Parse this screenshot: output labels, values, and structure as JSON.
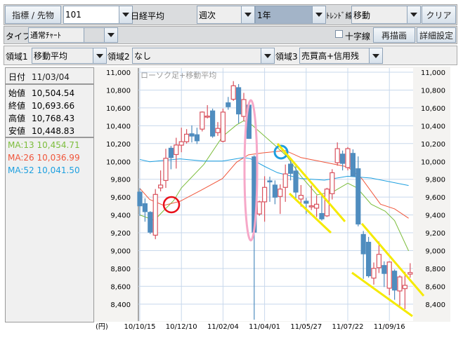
{
  "toolbar1": {
    "index_button": "指標 / 先物",
    "code_value": "101",
    "index_name": "日経平均",
    "period_value": "週次",
    "range_value": "1年",
    "trend_label": "ﾄﾚﾝﾄﾞ線",
    "trend_value": "移動",
    "clear_button": "クリア"
  },
  "toolbar2": {
    "type_label": "タイプ",
    "type_value": "通常ﾁｬｰﾄ",
    "crosshair_label": "十字線",
    "crosshair_checked": false,
    "redraw_button": "再描画",
    "settings_button": "詳細設定"
  },
  "toolbar3": {
    "area1_label": "領域1",
    "area1_value": "移動平均",
    "area2_label": "領域2",
    "area2_value": "なし",
    "area3_label": "領域3",
    "area3_value": "売買高+信用残"
  },
  "info": {
    "date_label": "日付",
    "date_value": "11/03/04",
    "open_label": "始値",
    "open_value": "10,504.54",
    "close_label": "終値",
    "close_value": "10,693.66",
    "high_label": "高値",
    "high_value": "10,768.43",
    "low_label": "安値",
    "low_value": "10,448.83",
    "ma13_label": "MA:13",
    "ma13_value": "10,454.71",
    "ma26_label": "MA:26",
    "ma26_value": "10,036.99",
    "ma52_label": "MA:52",
    "ma52_value": "10,041.50"
  },
  "colors": {
    "up": "#d9525e",
    "down": "#4f8dbf",
    "ma13": "#7cbd3c",
    "ma26": "#f0553a",
    "ma52": "#1ea0e0",
    "grid": "#c8d8ec"
  },
  "chart_data": {
    "type": "candlestick",
    "title": "ローソク足+移動平均",
    "unit_label": "(円)",
    "ylim": [
      8200,
      11000
    ],
    "yticks": [
      "11,000",
      "10,800",
      "10,600",
      "10,400",
      "10,200",
      "10,000",
      "9,800",
      "9,600",
      "9,400",
      "9,200",
      "9,000",
      "8,800",
      "8,600",
      "8,400"
    ],
    "ytick_values": [
      11000,
      10800,
      10600,
      10400,
      10200,
      10000,
      9800,
      9600,
      9400,
      9200,
      9000,
      8800,
      8600,
      8400
    ],
    "xticks": [
      {
        "index": 1,
        "label": "10/10/15"
      },
      {
        "index": 9,
        "label": "10/12/10"
      },
      {
        "index": 17,
        "label": "11/02/04"
      },
      {
        "index": 25,
        "label": "11/04/01"
      },
      {
        "index": 33,
        "label": "11/05/27"
      },
      {
        "index": 41,
        "label": "11/07/22"
      },
      {
        "index": 49,
        "label": "11/09/16"
      }
    ],
    "ohlc": [
      [
        9656,
        9700,
        9390,
        9502
      ],
      [
        9526,
        9586,
        9324,
        9437
      ],
      [
        9429,
        9442,
        9186,
        9207
      ],
      [
        9173,
        9690,
        9128,
        9630
      ],
      [
        9703,
        9899,
        9664,
        9735
      ],
      [
        9787,
        10142,
        9703,
        10035
      ],
      [
        10148,
        10174,
        9912,
        10043
      ],
      [
        10077,
        10265,
        9920,
        10184
      ],
      [
        10182,
        10378,
        10103,
        10221
      ],
      [
        10221,
        10362,
        10200,
        10305
      ],
      [
        10310,
        10404,
        10213,
        10284
      ],
      [
        10299,
        10378,
        10195,
        10231
      ],
      [
        10362,
        10561,
        10336,
        10553
      ],
      [
        10498,
        10631,
        10482,
        10508
      ],
      [
        10566,
        10592,
        10265,
        10284
      ],
      [
        10323,
        10441,
        10286,
        10370
      ],
      [
        10226,
        10592,
        10213,
        10553
      ],
      [
        10657,
        10723,
        10579,
        10613
      ],
      [
        10697,
        10900,
        10678,
        10848
      ],
      [
        10827,
        10867,
        10427,
        10532
      ],
      [
        10504.54,
        10768.43,
        10448.83,
        10693.66
      ],
      [
        10631,
        10657,
        10252,
        10258
      ],
      [
        10051,
        10069,
        8226,
        9207
      ],
      [
        9411,
        9560,
        9390,
        9547
      ],
      [
        9547,
        9834,
        9324,
        9709
      ],
      [
        9782,
        9829,
        9547,
        9771
      ],
      [
        9735,
        9787,
        9520,
        9599
      ],
      [
        9607,
        9743,
        9411,
        9690
      ],
      [
        9709,
        9965,
        9547,
        9860
      ],
      [
        9970,
        10017,
        9787,
        9866
      ],
      [
        9892,
        9952,
        9586,
        9656
      ],
      [
        9578,
        9735,
        9494,
        9620
      ],
      [
        9554,
        9591,
        9411,
        9531
      ],
      [
        9497,
        9730,
        9455,
        9502
      ],
      [
        9476,
        9620,
        9377,
        9520
      ],
      [
        9416,
        9638,
        9337,
        9356
      ],
      [
        9390,
        9704,
        9377,
        9690
      ],
      [
        9638,
        9913,
        9573,
        9873
      ],
      [
        9986,
        10213,
        9952,
        10143
      ],
      [
        10082,
        10122,
        9899,
        9978
      ],
      [
        9931,
        10161,
        9899,
        10143
      ],
      [
        10090,
        10135,
        9834,
        9834
      ],
      [
        9918,
        10056,
        9272,
        9298
      ],
      [
        9181,
        9220,
        8684,
        8964
      ],
      [
        9094,
        9154,
        8697,
        8718
      ],
      [
        8692,
        8867,
        8619,
        8801
      ],
      [
        8809,
        9102,
        8749,
        8958
      ],
      [
        8833,
        8880,
        8592,
        8744
      ],
      [
        8579,
        8880,
        8501,
        8872
      ],
      [
        8770,
        8789,
        8449,
        8558
      ],
      [
        8548,
        8723,
        8383,
        8705
      ],
      [
        8574,
        8762,
        8344,
        8611
      ],
      [
        8736,
        8859,
        8697,
        8754
      ]
    ],
    "series": [
      {
        "name": "MA:13",
        "points": [
          [
            1,
            9400
          ],
          [
            3.8,
            9340
          ],
          [
            5.6,
            9450
          ],
          [
            7.5,
            9560
          ],
          [
            9,
            9703
          ],
          [
            13.3,
            9965
          ],
          [
            16.9,
            10278
          ],
          [
            19.6,
            10409
          ],
          [
            21,
            10456
          ],
          [
            22.3,
            10422
          ],
          [
            24.6,
            10304
          ],
          [
            27,
            10180
          ],
          [
            29.3,
            10056
          ],
          [
            32,
            9834
          ],
          [
            35.1,
            9625
          ],
          [
            38.3,
            9664
          ],
          [
            41,
            9756
          ],
          [
            42.8,
            9703
          ],
          [
            45.5,
            9520
          ],
          [
            48.2,
            9442
          ],
          [
            50,
            9337
          ],
          [
            52.7,
            8997
          ]
        ]
      },
      {
        "name": "MA:26",
        "points": [
          [
            1,
            9698
          ],
          [
            2.9,
            9573
          ],
          [
            5.6,
            9507
          ],
          [
            8.7,
            9552
          ],
          [
            12.8,
            9677
          ],
          [
            16.9,
            9808
          ],
          [
            19.6,
            9991
          ],
          [
            21.9,
            10074
          ],
          [
            24.6,
            10095
          ],
          [
            29,
            10122
          ],
          [
            32,
            10043
          ],
          [
            36.5,
            9991
          ],
          [
            41,
            9938
          ],
          [
            43.7,
            9808
          ],
          [
            47.3,
            9520
          ],
          [
            50,
            9468
          ],
          [
            52.7,
            9363
          ]
        ]
      },
      {
        "name": "MA:52",
        "points": [
          [
            1,
            10022
          ],
          [
            2.9,
            9996
          ],
          [
            8.7,
            10028
          ],
          [
            13.3,
            10004
          ],
          [
            16.9,
            10004
          ],
          [
            21,
            10043
          ],
          [
            22.3,
            10030
          ],
          [
            25,
            9944
          ],
          [
            27.5,
            9873
          ],
          [
            32,
            9808
          ],
          [
            36.5,
            9790
          ],
          [
            41,
            9834
          ],
          [
            45.5,
            9813
          ],
          [
            50,
            9761
          ],
          [
            52.7,
            9730
          ]
        ]
      }
    ]
  }
}
